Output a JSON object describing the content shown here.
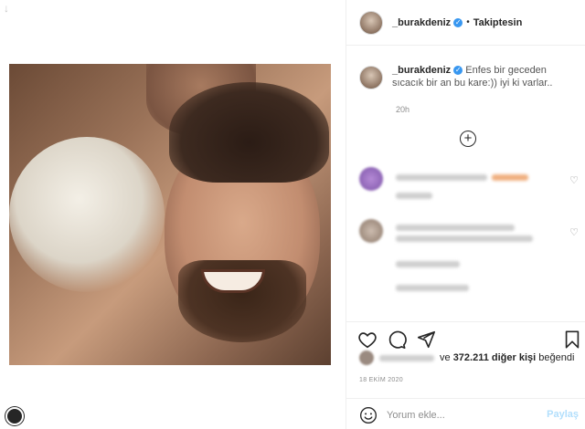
{
  "post": {
    "username": "_burakdeniz",
    "follow_status": "Takiptesin",
    "separator": "•",
    "verified_mark": "✓",
    "caption_user": "_burakdeniz",
    "caption_text": "Enfes bir geceden sıcacık bir an bu kare:)) iyi ki varlar..",
    "time_ago": "20h",
    "load_more_symbol": "+",
    "likes_text": "ve",
    "likes_count": "372.211 diğer kişi",
    "likes_suffix": "beğendi",
    "date": "18 EKİM 2020"
  },
  "comment_box": {
    "placeholder": "Yorum ekle...",
    "submit_label": "Paylaş"
  },
  "icons": {
    "top_arrow": "↓",
    "heart_small": "♡",
    "like": "heart-icon",
    "comment": "comment-icon",
    "share": "send-icon",
    "save": "bookmark-icon",
    "emoji": "smiley-icon"
  },
  "colors": {
    "verified": "#3897f0",
    "submit_disabled": "#b2dffc",
    "muted": "#8e8e8e"
  }
}
